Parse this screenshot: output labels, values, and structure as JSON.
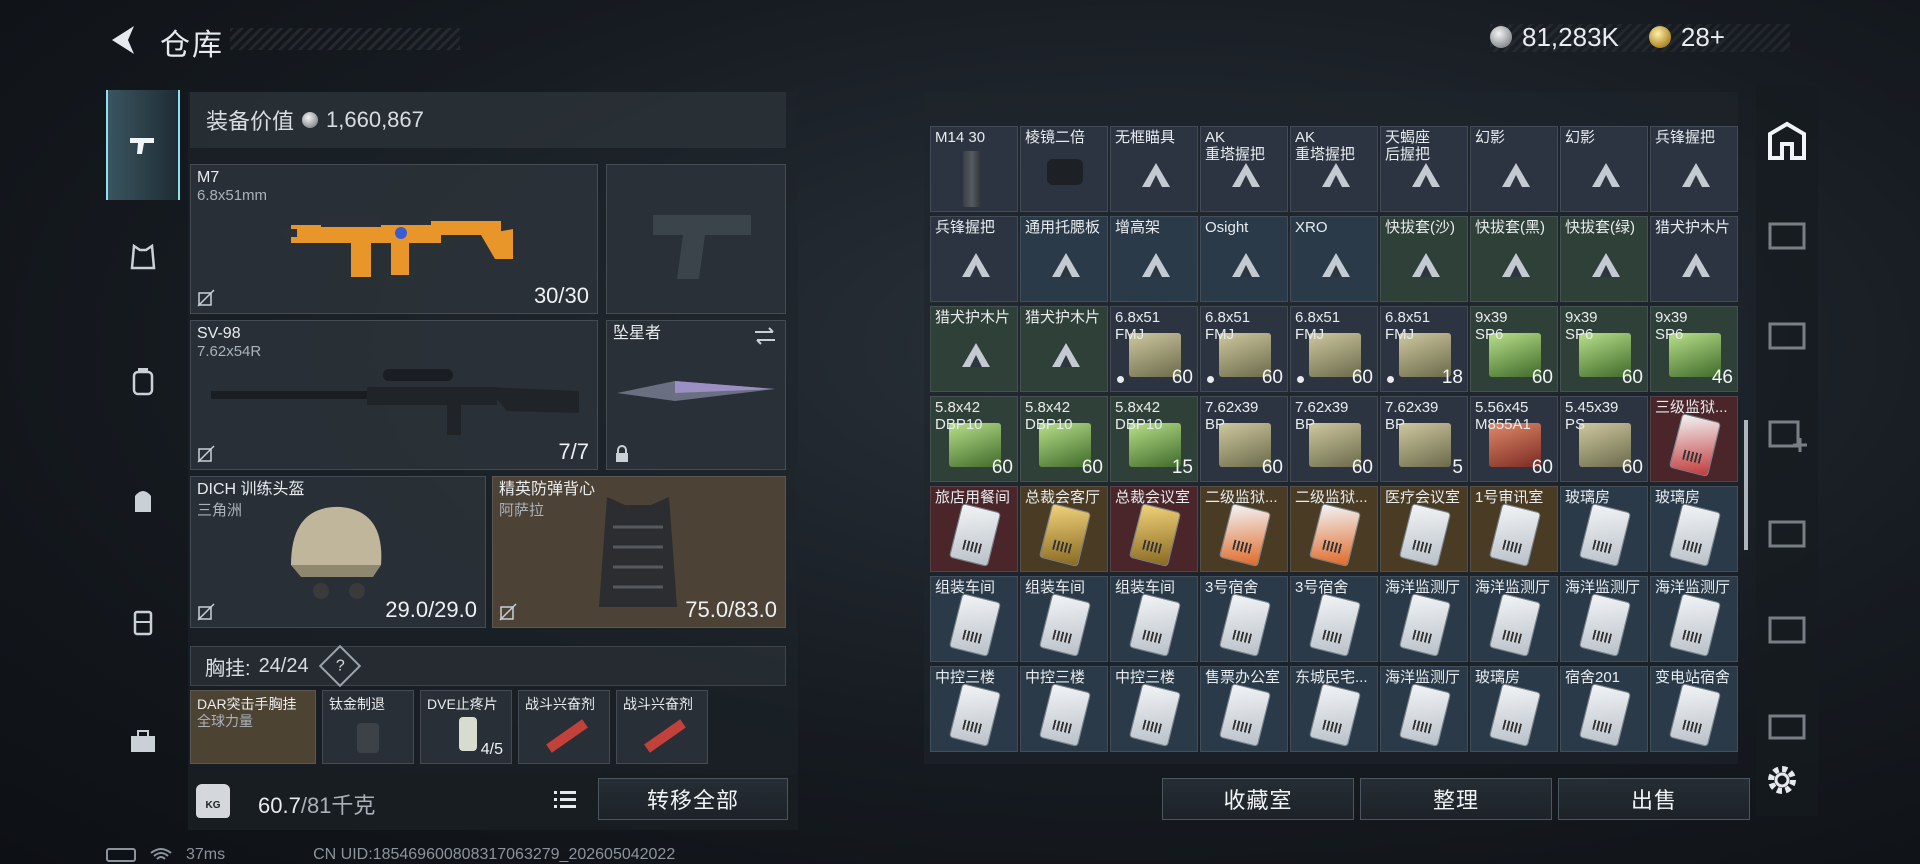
{
  "header": {
    "title": "仓库",
    "currency_amount": "81,283K",
    "premium_amount": "28+"
  },
  "loadout": {
    "equip_value_label": "装备价值",
    "equip_value": "1,660,867",
    "primary": {
      "name": "M7",
      "caliber": "6.8x51mm",
      "ammo": "30/30"
    },
    "secondary": {
      "name": "SV-98",
      "caliber": "7.62x54R",
      "ammo": "7/7"
    },
    "melee": {
      "name": "坠星者"
    },
    "helmet": {
      "name": "DICH 训练头盔",
      "origin": "三角洲",
      "durability": "29.0/29.0"
    },
    "armor": {
      "name": "精英防弹背心",
      "origin": "阿萨拉",
      "durability": "75.0/83.0"
    },
    "vest_label": "胸挂:",
    "vest_capacity": "24/24",
    "vest_items": [
      {
        "name": "DAR突击手胸挂",
        "sub": "全球力量"
      },
      {
        "name": "钛金制退"
      },
      {
        "name": "DVE止疼片",
        "qty": "4/5"
      },
      {
        "name": "战斗兴奋剂"
      },
      {
        "name": "战斗兴奋剂"
      }
    ],
    "weight": "60.7",
    "weight_total": "/81千克",
    "weight_icon": "KG",
    "transfer_all": "转移全部"
  },
  "storage": {
    "rows": [
      [
        {
          "l1": "M14 30",
          "kind": "mag",
          "bg": "c-dark"
        },
        {
          "l1": "棱镜二倍",
          "kind": "scope",
          "bg": "c-dark"
        },
        {
          "l1": "无框瞄具",
          "kind": "tri",
          "bg": "c-dark"
        },
        {
          "l1": "AK",
          "l2": "重塔握把",
          "kind": "tri",
          "bg": "c-dark"
        },
        {
          "l1": "AK",
          "l2": "重塔握把",
          "kind": "tri",
          "bg": "c-dark"
        },
        {
          "l1": "天蝎座",
          "l2": "后握把",
          "kind": "tri",
          "bg": "c-dark"
        },
        {
          "l1": "幻影",
          "kind": "tri",
          "bg": "c-dark"
        },
        {
          "l1": "幻影",
          "kind": "tri",
          "bg": "c-dark"
        },
        {
          "l1": "兵锋握把",
          "kind": "tri",
          "bg": "c-dark"
        }
      ],
      [
        {
          "l1": "兵锋握把",
          "kind": "tri",
          "bg": "c-dark"
        },
        {
          "l1": "通用托腮板",
          "kind": "tri",
          "bg": "c-blue"
        },
        {
          "l1": "增高架",
          "kind": "tri",
          "bg": "c-blue"
        },
        {
          "l1": "Osight",
          "kind": "tri",
          "bg": "c-blue"
        },
        {
          "l1": "XRO",
          "kind": "tri",
          "bg": "c-blue"
        },
        {
          "l1": "快拔套(沙)",
          "kind": "tri",
          "bg": "c-green"
        },
        {
          "l1": "快拔套(黑)",
          "kind": "tri",
          "bg": "c-green"
        },
        {
          "l1": "快拔套(绿)",
          "kind": "tri",
          "bg": "c-green"
        },
        {
          "l1": "猎犬护木片",
          "kind": "tri",
          "bg": "c-dark"
        }
      ],
      [
        {
          "l1": "猎犬护木片",
          "kind": "tri",
          "bg": "c-green"
        },
        {
          "l1": "猎犬护木片",
          "kind": "tri",
          "bg": "c-green"
        },
        {
          "l1": "6.8x51",
          "l2": "FMJ",
          "kind": "ammo-olive",
          "bg": "c-dark",
          "q": "60",
          "dot": true
        },
        {
          "l1": "6.8x51",
          "l2": "FMJ",
          "kind": "ammo-olive",
          "bg": "c-dark",
          "q": "60",
          "dot": true
        },
        {
          "l1": "6.8x51",
          "l2": "FMJ",
          "kind": "ammo-olive",
          "bg": "c-dark",
          "q": "60",
          "dot": true
        },
        {
          "l1": "6.8x51",
          "l2": "FMJ",
          "kind": "ammo-olive",
          "bg": "c-dark",
          "q": "18",
          "dot": true
        },
        {
          "l1": "9x39",
          "l2": "SP6",
          "kind": "ammo-green",
          "bg": "c-green",
          "q": "60"
        },
        {
          "l1": "9x39",
          "l2": "SP6",
          "kind": "ammo-green",
          "bg": "c-green",
          "q": "60"
        },
        {
          "l1": "9x39",
          "l2": "SP6",
          "kind": "ammo-green",
          "bg": "c-green",
          "q": "46"
        }
      ],
      [
        {
          "l1": "5.8x42",
          "l2": "DBP10",
          "kind": "ammo-green",
          "bg": "c-green",
          "q": "60"
        },
        {
          "l1": "5.8x42",
          "l2": "DBP10",
          "kind": "ammo-green",
          "bg": "c-green",
          "q": "60"
        },
        {
          "l1": "5.8x42",
          "l2": "DBP10",
          "kind": "ammo-green",
          "bg": "c-green",
          "q": "15"
        },
        {
          "l1": "7.62x39",
          "l2": "BP",
          "kind": "ammo-olive",
          "bg": "c-dark",
          "q": "60"
        },
        {
          "l1": "7.62x39",
          "l2": "BP",
          "kind": "ammo-olive",
          "bg": "c-dark",
          "q": "60"
        },
        {
          "l1": "7.62x39",
          "l2": "BP",
          "kind": "ammo-olive",
          "bg": "c-dark",
          "q": "5"
        },
        {
          "l1": "5.56x45",
          "l2": "M855A1",
          "kind": "ammo-red",
          "bg": "c-dark",
          "q": "60"
        },
        {
          "l1": "5.45x39",
          "l2": "PS",
          "kind": "ammo-olive",
          "bg": "c-dark",
          "q": "60"
        },
        {
          "l1": "三级监狱...",
          "kind": "card-red",
          "bg": "c-red"
        }
      ],
      [
        {
          "l1": "旅店用餐间",
          "kind": "card",
          "bg": "c-red"
        },
        {
          "l1": "总裁会客厅",
          "kind": "card-gold",
          "bg": "c-gold"
        },
        {
          "l1": "总裁会议室",
          "kind": "card-gold",
          "bg": "c-red"
        },
        {
          "l1": "二级监狱...",
          "kind": "card-orange",
          "bg": "c-gold"
        },
        {
          "l1": "二级监狱...",
          "kind": "card-orange",
          "bg": "c-gold"
        },
        {
          "l1": "医疗会议室",
          "kind": "card",
          "bg": "c-gold"
        },
        {
          "l1": "1号审讯室",
          "kind": "card",
          "bg": "c-gold"
        },
        {
          "l1": "玻璃房",
          "kind": "card",
          "bg": "c-blue"
        },
        {
          "l1": "玻璃房",
          "kind": "card",
          "bg": "c-blue"
        }
      ],
      [
        {
          "l1": "组装车间",
          "kind": "card",
          "bg": "c-blue"
        },
        {
          "l1": "组装车间",
          "kind": "card",
          "bg": "c-blue"
        },
        {
          "l1": "组装车间",
          "kind": "card",
          "bg": "c-blue"
        },
        {
          "l1": "3号宿舍",
          "kind": "card",
          "bg": "c-blue"
        },
        {
          "l1": "3号宿舍",
          "kind": "card",
          "bg": "c-blue"
        },
        {
          "l1": "海洋监测厅",
          "kind": "card",
          "bg": "c-blue"
        },
        {
          "l1": "海洋监测厅",
          "kind": "card",
          "bg": "c-blue"
        },
        {
          "l1": "海洋监测厅",
          "kind": "card",
          "bg": "c-blue"
        },
        {
          "l1": "海洋监测厅",
          "kind": "card",
          "bg": "c-blue"
        }
      ],
      [
        {
          "l1": "中控三楼",
          "kind": "card",
          "bg": "c-blue"
        },
        {
          "l1": "中控三楼",
          "kind": "card",
          "bg": "c-blue"
        },
        {
          "l1": "中控三楼",
          "kind": "card",
          "bg": "c-blue"
        },
        {
          "l1": "售票办公室",
          "kind": "card",
          "bg": "c-blue"
        },
        {
          "l1": "东城民宅...",
          "kind": "card",
          "bg": "c-blue"
        },
        {
          "l1": "海洋监测厅",
          "kind": "card",
          "bg": "c-blue"
        },
        {
          "l1": "玻璃房",
          "kind": "card",
          "bg": "c-blue"
        },
        {
          "l1": "宿舍201",
          "kind": "card",
          "bg": "c-blue"
        },
        {
          "l1": "变电站宿舍",
          "kind": "card",
          "bg": "c-blue"
        }
      ]
    ],
    "vault_button": "收藏室",
    "sort_button": "整理",
    "sell_button": "出售"
  },
  "status_bar": {
    "ping": "37ms",
    "uid": "CN UID:18546960080831706327​9_202605042022"
  },
  "colors": {
    "accent": "#8fdff0",
    "panel": "#2d3640"
  }
}
